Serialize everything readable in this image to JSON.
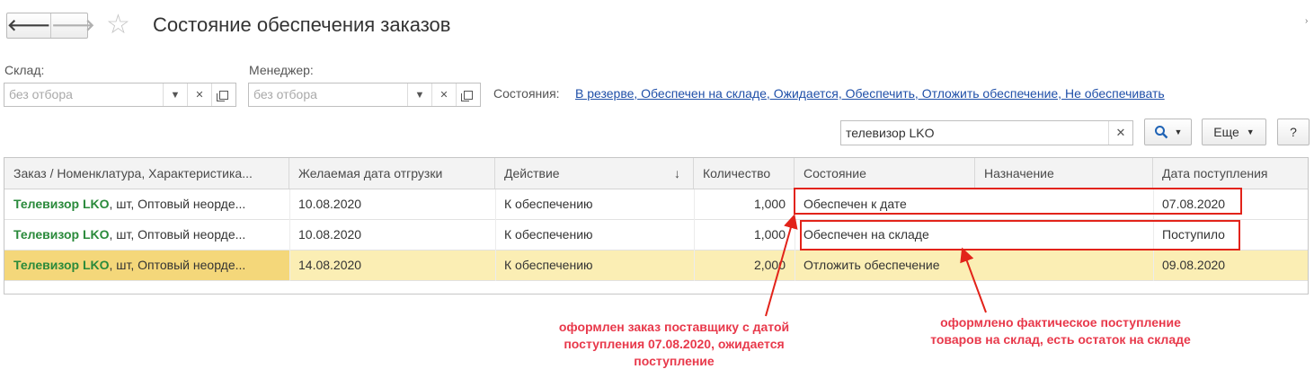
{
  "header": {
    "title": "Состояние обеспечения заказов",
    "back_glyph": "🡐",
    "forward_glyph": "🡒"
  },
  "filters": {
    "warehouse": {
      "label": "Склад:",
      "placeholder": "без отбора"
    },
    "manager": {
      "label": "Менеджер:",
      "placeholder": "без отбора"
    },
    "states_label": "Состояния:",
    "states_value": "В резерве, Обеспечен на складе, Ожидается, Обеспечить, Отложить обеспечение, Не обеспечивать"
  },
  "search": {
    "value": "телевизор LKO"
  },
  "toolbar": {
    "more_label": "Еще",
    "help_label": "?"
  },
  "table": {
    "columns": [
      "Заказ / Номенклатура, Характеристика...",
      "Желаемая дата отгрузки",
      "Действие",
      "Количество",
      "Состояние",
      "Назначение",
      "Дата поступления"
    ],
    "rows": [
      {
        "name": "Телевизор LKO",
        "name_rest": ", шт, Оптовый неорде...",
        "date": "10.08.2020",
        "action": "К обеспечению",
        "qty": "1,000",
        "state": "Обеспечен к дате",
        "purpose": "",
        "arrival": "07.08.2020"
      },
      {
        "name": "Телевизор LKO",
        "name_rest": ", шт, Оптовый неорде...",
        "date": "10.08.2020",
        "action": "К обеспечению",
        "qty": "1,000",
        "state": "Обеспечен на складе",
        "purpose": "",
        "arrival": "Поступило"
      },
      {
        "name": "Телевизор LKO",
        "name_rest": ", шт, Оптовый неорде...",
        "date": "14.08.2020",
        "action": "К обеспечению",
        "qty": "2,000",
        "state": "Отложить обеспечение",
        "purpose": "",
        "arrival": "09.08.2020"
      }
    ]
  },
  "annotations": {
    "note1": [
      "оформлен заказ поставщику с датой",
      "поступления 07.08.2020, ожидается",
      "поступление"
    ],
    "note2": [
      "оформлено фактическое поступление",
      "товаров на склад, есть остаток на складе"
    ]
  },
  "colors": {
    "annotation": "#e8394b",
    "selected_row": "#fbeeb4",
    "product_name": "#2a8a3b",
    "link": "#1f4fa8"
  }
}
